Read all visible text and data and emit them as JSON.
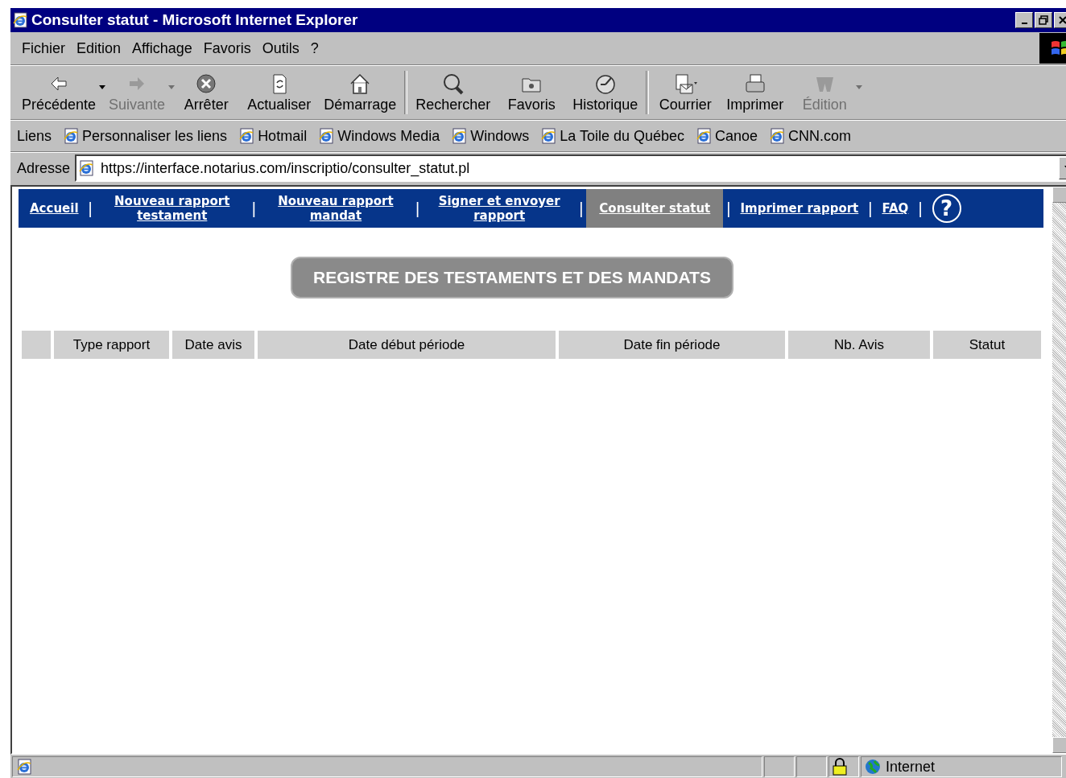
{
  "window": {
    "title": "Consulter statut - Microsoft Internet Explorer"
  },
  "menu": [
    "Fichier",
    "Edition",
    "Affichage",
    "Favoris",
    "Outils",
    "?"
  ],
  "toolbar": [
    {
      "label": "Précédente",
      "kind": "back",
      "disabled": false,
      "dropdown": true
    },
    {
      "label": "Suivante",
      "kind": "forward",
      "disabled": true,
      "dropdown": true
    },
    {
      "label": "Arrêter",
      "kind": "stop",
      "disabled": false,
      "dropdown": false
    },
    {
      "label": "Actualiser",
      "kind": "refresh",
      "disabled": false,
      "dropdown": false
    },
    {
      "label": "Démarrage",
      "kind": "home",
      "disabled": false,
      "dropdown": false
    },
    {
      "label": "Rechercher",
      "kind": "search",
      "disabled": false,
      "dropdown": false,
      "separator_before": true
    },
    {
      "label": "Favoris",
      "kind": "favorites",
      "disabled": false,
      "dropdown": false
    },
    {
      "label": "Historique",
      "kind": "history",
      "disabled": false,
      "dropdown": false
    },
    {
      "label": "Courrier",
      "kind": "mail",
      "disabled": false,
      "dropdown": false,
      "separator_before": true
    },
    {
      "label": "Imprimer",
      "kind": "print",
      "disabled": false,
      "dropdown": false
    },
    {
      "label": "Édition",
      "kind": "edit",
      "disabled": true,
      "dropdown": true
    }
  ],
  "links": {
    "label": "Liens",
    "items": [
      "Personnaliser les liens",
      "Hotmail",
      "Windows Media",
      "Windows",
      "La Toile du Québec",
      "Canoe",
      "CNN.com"
    ]
  },
  "address": {
    "label": "Adresse",
    "value": "https://interface.notarius.com/inscriptio/consulter_statut.pl"
  },
  "nav": [
    {
      "label": "Accueil",
      "selected": false
    },
    {
      "label": "Nouveau rapport testament",
      "selected": false
    },
    {
      "label": "Nouveau rapport mandat",
      "selected": false
    },
    {
      "label": "Signer et envoyer rapport",
      "selected": false
    },
    {
      "label": "Consulter statut",
      "selected": true
    },
    {
      "label": "Imprimer rapport",
      "selected": false
    },
    {
      "label": "FAQ",
      "selected": false
    },
    {
      "label": "?",
      "selected": false
    }
  ],
  "nav_separator": "|",
  "banner": "REGISTRE DES TESTAMENTS ET DES MANDATS",
  "table": {
    "columns": [
      "Type rapport",
      "Date avis",
      "Date début période",
      "Date fin période",
      "Nb. Avis",
      "Statut"
    ]
  },
  "status_bar": {
    "zone": "Internet"
  }
}
